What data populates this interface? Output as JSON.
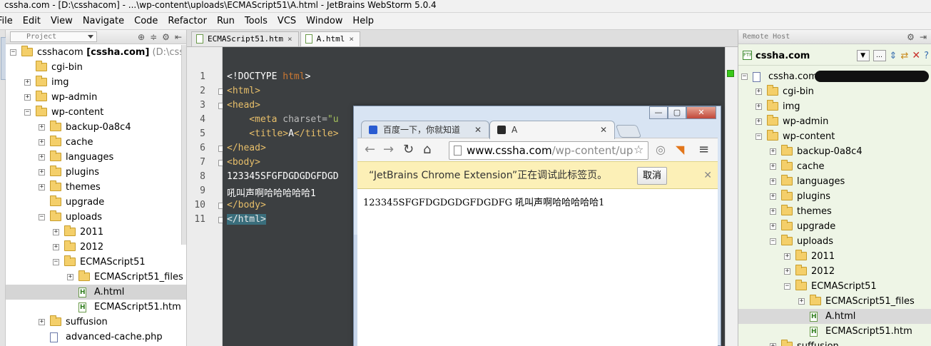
{
  "window": {
    "title": "cssha.com - [D:\\csshacom] - ...\\wp-content\\uploads\\ECMAScript51\\A.html - JetBrains WebStorm 5.0.4"
  },
  "menu": [
    "File",
    "Edit",
    "View",
    "Navigate",
    "Code",
    "Refactor",
    "Run",
    "Tools",
    "VCS",
    "Window",
    "Help"
  ],
  "project_panel": {
    "selector": "Project",
    "tree": [
      {
        "label": "csshacom",
        "bold": "[cssha.com]",
        "extra": "(D:\\csshaco",
        "level": 0,
        "type": "folder",
        "expanded": true
      },
      {
        "label": "cgi-bin",
        "level": 1,
        "type": "folder"
      },
      {
        "label": "img",
        "level": 1,
        "type": "folder",
        "expand": true
      },
      {
        "label": "wp-admin",
        "level": 1,
        "type": "folder",
        "expand": true
      },
      {
        "label": "wp-content",
        "level": 1,
        "type": "folder",
        "expanded": true
      },
      {
        "label": "backup-0a8c4",
        "level": 2,
        "type": "folder",
        "expand": true
      },
      {
        "label": "cache",
        "level": 2,
        "type": "folder",
        "expand": true
      },
      {
        "label": "languages",
        "level": 2,
        "type": "folder",
        "expand": true
      },
      {
        "label": "plugins",
        "level": 2,
        "type": "folder",
        "expand": true
      },
      {
        "label": "themes",
        "level": 2,
        "type": "folder",
        "expand": true
      },
      {
        "label": "upgrade",
        "level": 2,
        "type": "folder"
      },
      {
        "label": "uploads",
        "level": 2,
        "type": "folder",
        "expanded": true
      },
      {
        "label": "2011",
        "level": 3,
        "type": "folder",
        "expand": true
      },
      {
        "label": "2012",
        "level": 3,
        "type": "folder",
        "expand": true
      },
      {
        "label": "ECMAScript51",
        "level": 3,
        "type": "folder",
        "expanded": true
      },
      {
        "label": "ECMAScript51_files",
        "level": 4,
        "type": "folder",
        "expand": true
      },
      {
        "label": "A.html",
        "level": 4,
        "type": "file",
        "selected": true
      },
      {
        "label": "ECMAScript51.htm",
        "level": 4,
        "type": "file"
      },
      {
        "label": "suffusion",
        "level": 2,
        "type": "folder",
        "expand": true
      },
      {
        "label": "advanced-cache.php",
        "level": 2,
        "type": "php"
      }
    ]
  },
  "editor": {
    "tabs": [
      {
        "label": "ECMAScript51.htm",
        "active": false
      },
      {
        "label": "A.html",
        "active": true
      }
    ],
    "line_numbers": [
      "1",
      "2",
      "3",
      "4",
      "5",
      "6",
      "7",
      "8",
      "9",
      "10",
      "11"
    ],
    "lines": {
      "l1a": "<!DOCTYPE ",
      "l1b": "html",
      "l1c": ">",
      "l2": "<html>",
      "l3": "<head>",
      "l4a": "    <meta ",
      "l4b": "charset=",
      "l4c": "\"u",
      "l5a": "    <title>",
      "l5b": "A",
      "l5c": "</title>",
      "l6": "</head>",
      "l7": "<body>",
      "l8": "123345SFGFDGDGDGFDGD",
      "l9": "吼叫声啊哈哈哈哈哈1",
      "l10": "</body>",
      "l11": "</html>"
    }
  },
  "remote_panel": {
    "title": "Remote Host",
    "host": "cssha.com",
    "tree": [
      {
        "label": "cssha.com (",
        "level": 0,
        "type": "ftp",
        "expanded": true
      },
      {
        "label": "cgi-bin",
        "level": 1,
        "type": "folder",
        "expand": true
      },
      {
        "label": "img",
        "level": 1,
        "type": "folder",
        "expand": true
      },
      {
        "label": "wp-admin",
        "level": 1,
        "type": "folder",
        "expand": true
      },
      {
        "label": "wp-content",
        "level": 1,
        "type": "folder",
        "expanded": true
      },
      {
        "label": "backup-0a8c4",
        "level": 2,
        "type": "folder",
        "expand": true
      },
      {
        "label": "cache",
        "level": 2,
        "type": "folder",
        "expand": true
      },
      {
        "label": "languages",
        "level": 2,
        "type": "folder",
        "expand": true
      },
      {
        "label": "plugins",
        "level": 2,
        "type": "folder",
        "expand": true
      },
      {
        "label": "themes",
        "level": 2,
        "type": "folder",
        "expand": true
      },
      {
        "label": "upgrade",
        "level": 2,
        "type": "folder",
        "expand": true
      },
      {
        "label": "uploads",
        "level": 2,
        "type": "folder",
        "expanded": true
      },
      {
        "label": "2011",
        "level": 3,
        "type": "folder",
        "expand": true
      },
      {
        "label": "2012",
        "level": 3,
        "type": "folder",
        "expand": true
      },
      {
        "label": "ECMAScript51",
        "level": 3,
        "type": "folder",
        "expanded": true
      },
      {
        "label": "ECMAScript51_files",
        "level": 4,
        "type": "folder",
        "expand": true
      },
      {
        "label": "A.html",
        "level": 4,
        "type": "file",
        "selected": true
      },
      {
        "label": "ECMAScript51.htm",
        "level": 4,
        "type": "file"
      },
      {
        "label": "suffusion",
        "level": 2,
        "type": "folder",
        "expand": true
      }
    ]
  },
  "browser": {
    "tab1": "百度一下，你就知道",
    "tab2": "A",
    "url_host": "www.cssha.com",
    "url_path": "/wp-content/up",
    "infobar_text": "“JetBrains Chrome Extension”正在调试此标签页。",
    "cancel_label": "取消",
    "page_text": "123345SFGFDGDGDGFDGDFG 吼叫声啊哈哈哈哈哈1"
  },
  "colors": {
    "editor_bg": "#3c3f41",
    "tag": "#e8bf6a",
    "string": "#a5c25c",
    "remote_bg": "#eef5e6",
    "infobar_bg": "#fcf0b7"
  }
}
